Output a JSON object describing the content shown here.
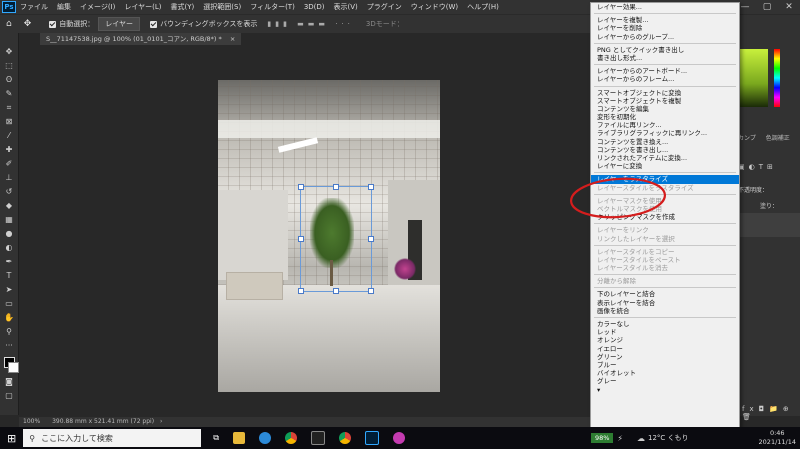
{
  "menubar": {
    "logo": "Ps",
    "items": [
      "ファイル",
      "編集",
      "イメージ(I)",
      "レイヤー(L)",
      "書式(Y)",
      "選択範囲(S)",
      "フィルター(T)",
      "3D(D)",
      "表示(V)",
      "プラグイン",
      "ウィンドウ(W)",
      "ヘルプ(H)"
    ],
    "win_minimize": "—",
    "win_maximize": "▢",
    "win_close": "✕"
  },
  "options": {
    "auto_select_label": "自動選択：",
    "auto_select_value": "レイヤー",
    "bounding_box_label": "バウンディングボックスを表示",
    "mode_3d_label": "3Dモード："
  },
  "document": {
    "tab_label": "S__71147538.jpg @ 100% (01_0101_コアン, RGB/8*) *",
    "tab_close": "×"
  },
  "status": {
    "zoom": "100%",
    "dimensions": "390.88 mm x 521.41 mm (72 ppi)",
    "arrow": "›"
  },
  "panel": {
    "tab_swatches": "カンプ",
    "tab_colors": "色調補正",
    "opacity_label": "不透明度：",
    "fill_label": "塗り："
  },
  "context_menu": {
    "items": [
      {
        "label": "レイヤー効果...",
        "state": "enabled"
      },
      {
        "sep": true
      },
      {
        "label": "レイヤーを複製...",
        "state": "enabled"
      },
      {
        "label": "レイヤーを削除",
        "state": "enabled"
      },
      {
        "label": "レイヤーからのグループ...",
        "state": "enabled"
      },
      {
        "sep": true
      },
      {
        "label": "PNG としてクイック書き出し",
        "state": "enabled"
      },
      {
        "label": "書き出し形式...",
        "state": "enabled"
      },
      {
        "sep": true
      },
      {
        "label": "レイヤーからのアートボード...",
        "state": "enabled"
      },
      {
        "label": "レイヤーからのフレーム...",
        "state": "enabled"
      },
      {
        "sep": true
      },
      {
        "label": "スマートオブジェクトに変換",
        "state": "enabled"
      },
      {
        "label": "スマートオブジェクトを複製",
        "state": "enabled"
      },
      {
        "label": "コンテンツを編集",
        "state": "enabled"
      },
      {
        "label": "変形を初期化",
        "state": "enabled"
      },
      {
        "label": "ファイルに再リンク...",
        "state": "enabled"
      },
      {
        "label": "ライブラリグラフィックに再リンク...",
        "state": "enabled"
      },
      {
        "label": "コンテンツを置き換え...",
        "state": "enabled"
      },
      {
        "label": "コンテンツを書き出し...",
        "state": "enabled"
      },
      {
        "label": "リンクされたアイテムに変換...",
        "state": "enabled"
      },
      {
        "label": "レイヤーに変換",
        "state": "enabled"
      },
      {
        "sep": true
      },
      {
        "label": "レイヤーをラスタライズ",
        "state": "selected"
      },
      {
        "label": "レイヤースタイルをラスタライズ",
        "state": "disabled"
      },
      {
        "sep": true
      },
      {
        "label": "レイヤーマスクを使用",
        "state": "disabled"
      },
      {
        "label": "ベクトルマスクを使用",
        "state": "disabled"
      },
      {
        "label": "クリッピングマスクを作成",
        "state": "enabled"
      },
      {
        "sep": true
      },
      {
        "label": "レイヤーをリンク",
        "state": "disabled"
      },
      {
        "label": "リンクしたレイヤーを選択",
        "state": "disabled"
      },
      {
        "sep": true
      },
      {
        "label": "レイヤースタイルをコピー",
        "state": "disabled"
      },
      {
        "label": "レイヤースタイルをペースト",
        "state": "disabled"
      },
      {
        "label": "レイヤースタイルを消去",
        "state": "disabled"
      },
      {
        "sep": true
      },
      {
        "label": "分離から解除",
        "state": "disabled"
      },
      {
        "sep": true
      },
      {
        "label": "下のレイヤーと結合",
        "state": "enabled"
      },
      {
        "label": "表示レイヤーを結合",
        "state": "enabled"
      },
      {
        "label": "画像を統合",
        "state": "enabled"
      },
      {
        "sep": true
      },
      {
        "label": "カラーなし",
        "state": "enabled"
      },
      {
        "label": "レッド",
        "state": "enabled"
      },
      {
        "label": "オレンジ",
        "state": "enabled"
      },
      {
        "label": "イエロー",
        "state": "enabled"
      },
      {
        "label": "グリーン",
        "state": "enabled"
      },
      {
        "label": "ブルー",
        "state": "enabled"
      },
      {
        "label": "バイオレット",
        "state": "enabled"
      },
      {
        "label": "グレー",
        "state": "enabled"
      }
    ],
    "scroll_arrow": "▾"
  },
  "taskbar": {
    "search_placeholder": "ここに入力して検索",
    "battery": "98%",
    "weather": "12°C くもり",
    "time": "0:46",
    "date": "2021/11/14"
  },
  "colors": {
    "menu_highlight": "#0078d7",
    "annotation_circle": "#d41d1d"
  }
}
